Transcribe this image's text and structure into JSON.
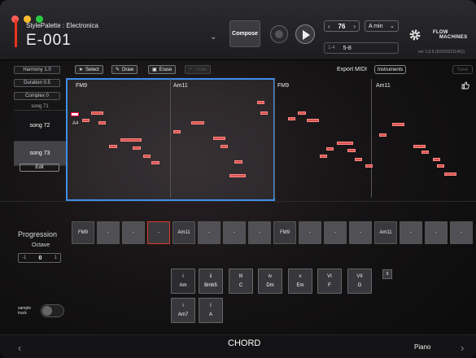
{
  "header": {
    "style_palette": "StylePalette : Electronica",
    "project": "E-001",
    "compose_label": "Compose",
    "tempo": "76",
    "key": "A min",
    "range_start": "1-4",
    "range_value": "5-8",
    "brand_line1": "FLOW",
    "brand_line2": "MACHINES",
    "version": "ver 1.0.9 (202202211451)"
  },
  "toolbar": {
    "select": "Select",
    "draw": "Draw",
    "erase": "Erase",
    "undo": "Undo",
    "export_midi": "Export MIDI",
    "instruments": "Instruments",
    "save": "Save"
  },
  "params": {
    "harmony": "Harmony 1.0",
    "duration": "Duration 0.5",
    "complex": "Complex 0"
  },
  "songs": {
    "partial": "song 71",
    "items": [
      "song 72",
      "song 73"
    ],
    "edit": "Edit"
  },
  "roll": {
    "chords": [
      "FM9",
      "Am11",
      "FM9",
      "Am11"
    ],
    "pitch_label": "A4"
  },
  "progression": {
    "label": "Progression",
    "octave_label": "Octave",
    "octave_minus": "-1",
    "octave_value": "0",
    "octave_plus": "1",
    "cells": [
      "FM9",
      "-",
      "-",
      "-",
      "Am11",
      "-",
      "-",
      "-",
      "FM9",
      "-",
      "-",
      "-",
      "Am11",
      "-",
      "-",
      "-"
    ]
  },
  "chord_pad": {
    "row1": [
      {
        "degree": "i",
        "name": "Am"
      },
      {
        "degree": "ii",
        "name": "Bmb5"
      },
      {
        "degree": "III",
        "name": "C"
      },
      {
        "degree": "iv",
        "name": "Dm"
      },
      {
        "degree": "v",
        "name": "Em"
      },
      {
        "degree": "VI",
        "name": "F"
      },
      {
        "degree": "VII",
        "name": "G"
      }
    ],
    "extra": "9",
    "row2": [
      {
        "degree": "i",
        "name": "Am7"
      },
      {
        "degree": "I",
        "name": "A"
      }
    ]
  },
  "sample_track": "sample track",
  "footer": {
    "title": "CHORD",
    "instrument": "Piano"
  },
  "colors": {
    "accent": "#e8341c",
    "selection": "#3f8ee8",
    "note": "#d8514e"
  }
}
